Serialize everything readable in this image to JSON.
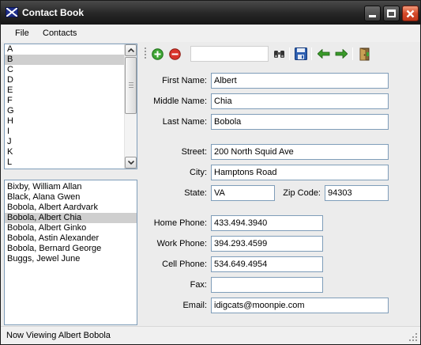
{
  "window": {
    "title": "Contact Book",
    "icon": "scotland-flag-icon"
  },
  "menu": {
    "file": "File",
    "contacts": "Contacts"
  },
  "letters": {
    "items": [
      "A",
      "B",
      "C",
      "D",
      "E",
      "F",
      "G",
      "H",
      "I",
      "J",
      "K",
      "L"
    ],
    "selected": "B"
  },
  "contacts": {
    "items": [
      "Bixby, William Allan",
      "Black, Alana Gwen",
      "Bobola, Albert Aardvark",
      "Bobola, Albert Chia",
      "Bobola, Albert Ginko",
      "Bobola, Astin Alexander",
      "Bobola, Bernard George",
      "Buggs, Jewel June"
    ],
    "selected": "Bobola, Albert Chia"
  },
  "toolbar": {
    "search_value": "",
    "icons": [
      "add-contact-icon",
      "remove-contact-icon",
      "binoculars-icon",
      "save-icon",
      "back-arrow-icon",
      "forward-arrow-icon",
      "exit-door-icon"
    ]
  },
  "form": {
    "first_name": {
      "label": "First Name:",
      "value": "Albert"
    },
    "middle_name": {
      "label": "Middle Name:",
      "value": "Chia"
    },
    "last_name": {
      "label": "Last Name:",
      "value": "Bobola"
    },
    "street": {
      "label": "Street:",
      "value": "200 North Squid Ave"
    },
    "city": {
      "label": "City:",
      "value": "Hamptons Road"
    },
    "state": {
      "label": "State:",
      "value": "VA"
    },
    "zip": {
      "label": "Zip Code:",
      "value": "94303"
    },
    "home_phone": {
      "label": "Home Phone:",
      "value": "433.494.3940"
    },
    "work_phone": {
      "label": "Work Phone:",
      "value": "394.293.4599"
    },
    "cell_phone": {
      "label": "Cell Phone:",
      "value": "534.649.4954"
    },
    "fax": {
      "label": "Fax:",
      "value": ""
    },
    "email": {
      "label": "Email:",
      "value": "idigcats@moonpie.com"
    }
  },
  "status": {
    "text": "Now Viewing Albert Bobola"
  },
  "colors": {
    "selection": "#cfcfcf",
    "input_border": "#7f9db9",
    "close_button": "#d44a2a",
    "add_green": "#3fa535",
    "remove_red": "#d9342b",
    "save_blue": "#2d5fb0",
    "arrow_green": "#3a9a2a"
  }
}
